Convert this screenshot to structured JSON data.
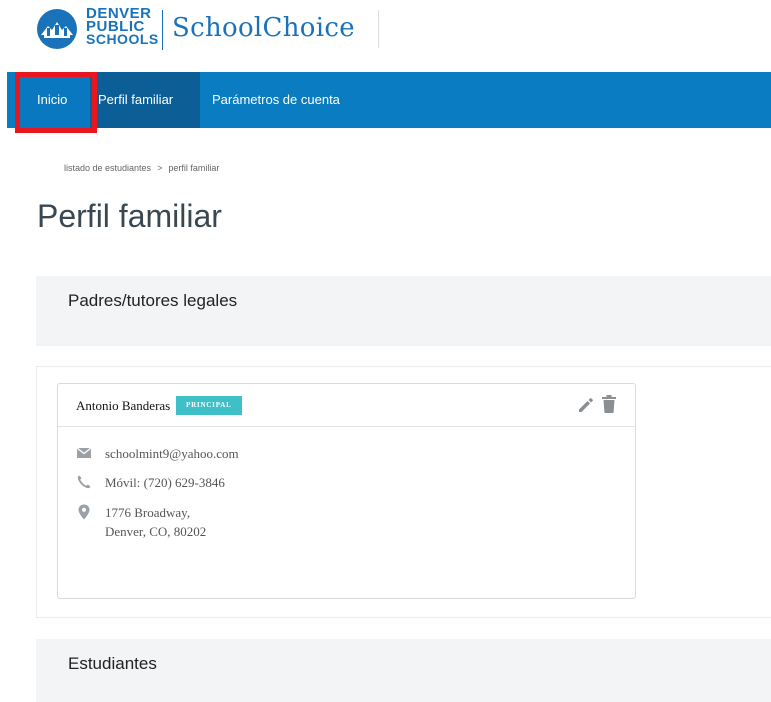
{
  "brand": {
    "line1": "DENVER",
    "line2": "PUBLIC",
    "line3": "SCHOOLS",
    "product": "SchoolChoice",
    "color": "#1a73ba"
  },
  "nav": {
    "home": "Inicio",
    "profile": "Perfil familiar",
    "settings": "Parámetros de cuenta",
    "bar_color": "#0a7cc2",
    "highlight_color": "#e8161e"
  },
  "breadcrumb": {
    "item1": "listado de estudiantes",
    "separator": ">",
    "item2": "perfil familiar"
  },
  "page": {
    "title": "Perfil familiar"
  },
  "guardians_section": {
    "title": "Padres/tutores legales",
    "guardian": {
      "name": "Antonio Banderas",
      "badge": "PRINCIPAL",
      "badge_color": "#3fc0c9",
      "email": "schoolmint9@yahoo.com",
      "phone": "Móvil: (720) 629-3846",
      "address_line1": "1776 Broadway,",
      "address_line2": "Denver, CO, 80202",
      "icons": {
        "email": "envelope-icon",
        "phone": "phone-icon",
        "address": "map-pin-icon",
        "edit": "pencil-icon",
        "delete": "trash-icon"
      }
    }
  },
  "students_section": {
    "title": "Estudiantes"
  }
}
